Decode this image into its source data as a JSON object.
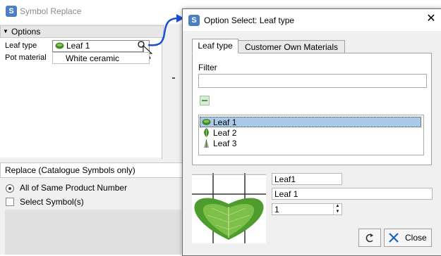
{
  "background_window": {
    "title": "Symbol Replace",
    "options_header": "Options",
    "properties": [
      {
        "label": "Leaf type",
        "value": "Leaf 1"
      },
      {
        "label": "Pot material",
        "value": "White ceramic"
      }
    ],
    "replace_header": "Replace (Catalogue Symbols only)",
    "radio_label": "All of Same Product Number",
    "checkbox_label": "Select Symbol(s)"
  },
  "dialog": {
    "title": "Option Select: Leaf type",
    "tabs": [
      {
        "label": "Leaf type",
        "selected": true
      },
      {
        "label": "Customer Own Materials",
        "selected": false
      }
    ],
    "filter_label": "Filter",
    "filter_value": "",
    "tree_items": [
      {
        "label": "Leaf 1",
        "selected": true
      },
      {
        "label": "Leaf 2",
        "selected": false
      },
      {
        "label": "Leaf 3",
        "selected": false
      }
    ],
    "code": "Leaf1",
    "name": "Leaf 1",
    "quantity": "1",
    "close_label": "Close"
  },
  "colors": {
    "accent_arrow": "#1d4fd6",
    "selection": "#a9c9e8",
    "app_icon": "#4a7fc1"
  },
  "icons": [
    "app-logo-icon",
    "magnifier-icon",
    "mouse-cursor-icon",
    "leaf-icon",
    "collapse-icon",
    "reset-icon",
    "close-x-icon"
  ]
}
